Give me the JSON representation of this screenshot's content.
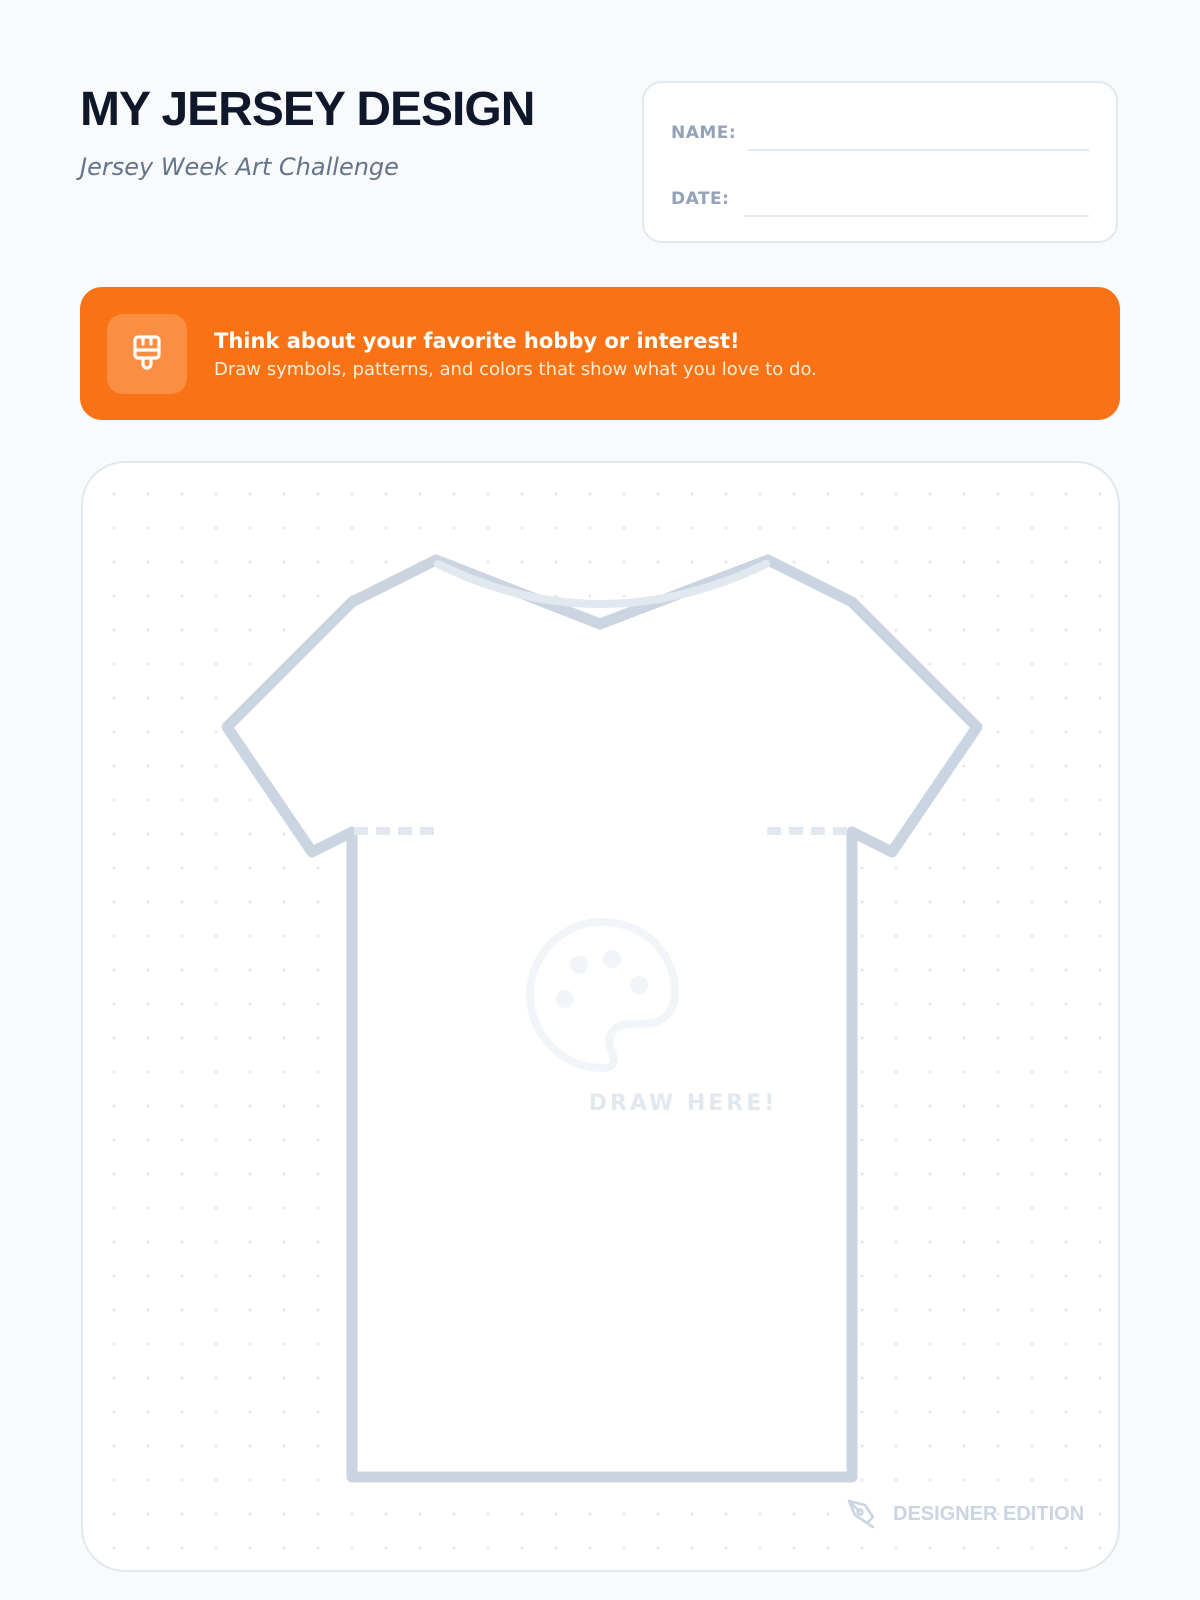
{
  "header": {
    "title": "MY JERSEY DESIGN",
    "subtitle": "Jersey Week Art Challenge"
  },
  "info_card": {
    "name_label": "NAME:",
    "date_label": "DATE:"
  },
  "prompt_banner": {
    "icon": "paintbrush-icon",
    "heading": "Think about your favorite hobby or interest!",
    "body": "Draw symbols, patterns, and colors that show what you love to do."
  },
  "canvas": {
    "center_icon": "palette-icon",
    "placeholder": "DRAW HERE!",
    "footer_icon": "pen-tool-icon",
    "footer_label": "DESIGNER EDITION"
  },
  "colors": {
    "background": "#f8fafc",
    "accent": "#f97316",
    "title": "#0f172a",
    "muted": "#64748b",
    "outline": "#cbd5e1",
    "border": "#e2e8f0"
  }
}
